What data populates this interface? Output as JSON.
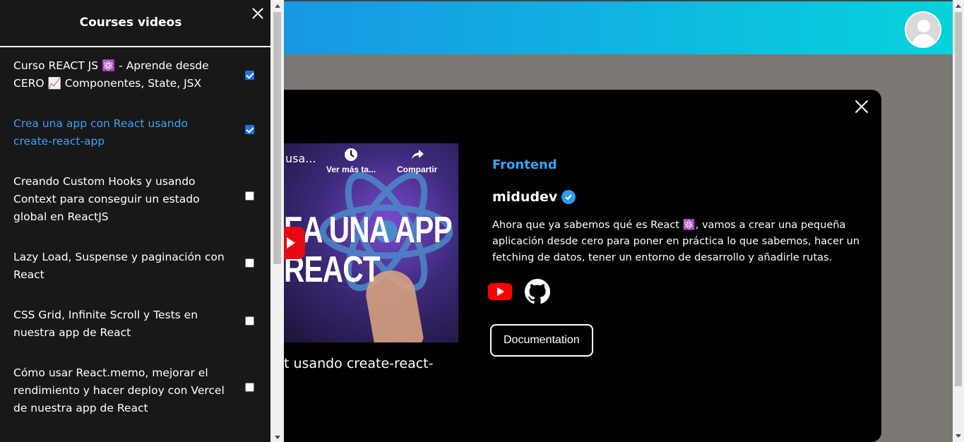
{
  "header": {
    "avatar_icon": "user-avatar-icon"
  },
  "sidebar": {
    "title": "Courses videos",
    "courses": [
      {
        "label": "Curso REACT JS ⚛️ - Aprende desde CERO 📈 Componentes, State, JSX",
        "checked": true,
        "active": false
      },
      {
        "label": "Crea una app con React usando create-react-app",
        "checked": true,
        "active": true
      },
      {
        "label": "Creando Custom Hooks y usando Context para conseguir un estado global en ReactJS",
        "checked": false,
        "active": false
      },
      {
        "label": "Lazy Load, Suspense y paginación con React",
        "checked": false,
        "active": false
      },
      {
        "label": "CSS Grid, Infinite Scroll y Tests en nuestra app de React",
        "checked": false,
        "active": false
      },
      {
        "label": "Cómo usar React.memo, mejorar el rendimiento y hacer deploy con Vercel de nuestra app de React",
        "checked": false,
        "active": false
      }
    ]
  },
  "modal": {
    "video": {
      "title_truncated": "usa...",
      "watch_later": "Ver más ta...",
      "share": "Compartir",
      "thumbnail_text_line1": "EA UNA APP",
      "thumbnail_text_line2": "REACT"
    },
    "caption": "t usando create-react-",
    "category": "Frontend",
    "author": "midudev",
    "description": "Ahora que ya sabemos qué es React ⚛️, vamos a crear una pequeña aplicación desde cero para poner en práctica lo que sabemos, hacer un fetching de datos, tener un entorno de desarrollo y añadirle rutas.",
    "documentation_label": "Documentation"
  },
  "colors": {
    "accent_blue": "#37a4f5",
    "checkbox_blue": "#1a73e8",
    "youtube_red": "#ff0000",
    "header_gradient_start": "#1f7fe3",
    "header_gradient_end": "#06d3dc"
  }
}
